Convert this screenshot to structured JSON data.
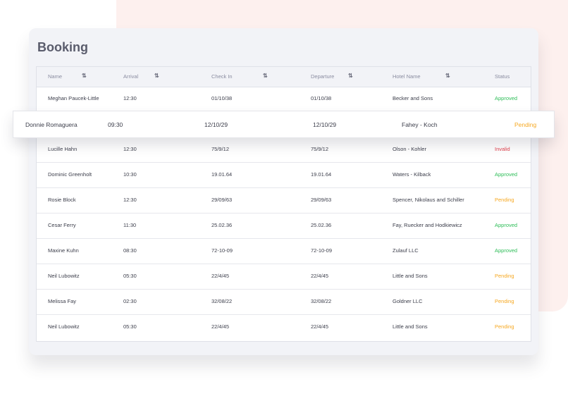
{
  "colors": {
    "approved": "#2ebd58",
    "pending": "#f6a821",
    "invalid": "#e2414c",
    "accent_bg": "#fdf0ee"
  },
  "page": {
    "title": "Booking"
  },
  "table": {
    "columns": [
      "Name",
      "Arrival",
      "Check In",
      "Departure",
      "Hotel Name",
      "Status"
    ],
    "sort_icon": "sort-arrows-icon",
    "sort_glyph": "⇅",
    "rows": [
      {
        "name": "Meghan Paucek-Little",
        "arrival": "12:30",
        "check_in": "01/10/38",
        "departure": "01/10/38",
        "hotel": "Becker and Sons",
        "status": "Approved"
      },
      {
        "name": "Donnie Romaguera",
        "arrival": "09:30",
        "check_in": "12/10/29",
        "departure": "12/10/29",
        "hotel": "Fahey - Koch",
        "status": "Pending"
      },
      {
        "name": "Lucille Hahn",
        "arrival": "12:30",
        "check_in": "75/9/12",
        "departure": "75/9/12",
        "hotel": "Olson - Kohler",
        "status": "Invalid"
      },
      {
        "name": "Dominic Greenholt",
        "arrival": "10:30",
        "check_in": "19.01.64",
        "departure": "19.01.64",
        "hotel": "Waters - Kilback",
        "status": "Approved"
      },
      {
        "name": "Rosie Block",
        "arrival": "12:30",
        "check_in": "29/09/63",
        "departure": "29/09/63",
        "hotel": "Spencer, Nikolaus and Schiller",
        "status": "Pending"
      },
      {
        "name": "Cesar Ferry",
        "arrival": "11:30",
        "check_in": "25.02.36",
        "departure": "25.02.36",
        "hotel": "Fay, Ruecker and Hodkiewicz",
        "status": "Approved"
      },
      {
        "name": "Maxine Kuhn",
        "arrival": "08:30",
        "check_in": "72-10-09",
        "departure": "72-10-09",
        "hotel": "Zulauf LLC",
        "status": "Approved"
      },
      {
        "name": "Neil Lubowitz",
        "arrival": "05:30",
        "check_in": "22/4/45",
        "departure": "22/4/45",
        "hotel": "Little and Sons",
        "status": "Pending"
      },
      {
        "name": "Melissa Fay",
        "arrival": "02:30",
        "check_in": "32/08/22",
        "departure": "32/08/22",
        "hotel": "Goldner LLC",
        "status": "Pending"
      },
      {
        "name": "Neil Lubowitz",
        "arrival": "05:30",
        "check_in": "22/4/45",
        "departure": "22/4/45",
        "hotel": "Little and Sons",
        "status": "Pending"
      }
    ]
  }
}
